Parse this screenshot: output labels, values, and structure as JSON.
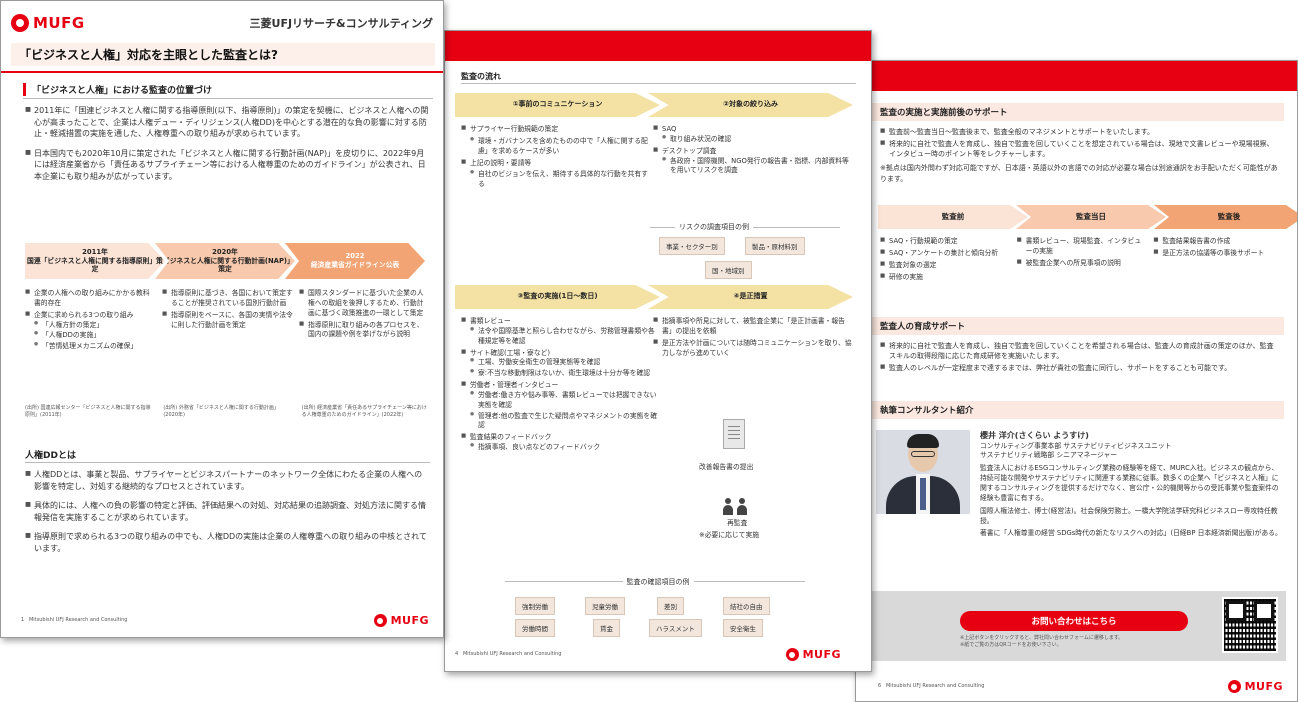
{
  "colors": {
    "brand_red": "#e60012",
    "salmon": "#fdf0ea",
    "gold": "#f4e2a5",
    "peach": "#f8c9ad",
    "orange": "#f2a474"
  },
  "page1": {
    "logo": "MUFG",
    "company": "三菱UFJリサーチ&コンサルティング",
    "title": "「ビジネスと人権」対応を主眼とした監査とは?",
    "section1": "「ビジネスと人権」における監査の位置づけ",
    "intro": [
      "2011年に「国連ビジネスと人権に関する指導原則(以下、指導原則)」の策定を契機に、ビジネスと人権への関心が高まったことで、企業は人権デュー・ディリジェンス(人権DD)を中心とする潜在的な負の影響に対する防止・軽減措置の実施を通した、人権尊重への取り組みが求められています。",
      "日本国内でも2020年10月に策定された「ビジネスと人権に関する行動計画(NAP)」を皮切りに、2022年9月には経済産業省から「責任あるサプライチェーン等における人権尊重のためのガイドライン」が公表され、日本企業にも取り組みが広がっています。"
    ],
    "timeline": [
      {
        "year": "2011年",
        "label": "国連「ビジネスと人権に関する指導原則」策定"
      },
      {
        "year": "2020年",
        "label": "「ビジネスと人権に関する行動計画(NAP)」策定"
      },
      {
        "year": "2022",
        "label": "経済産業省ガイドライン公表"
      }
    ],
    "col1": [
      "企業の人権への取り組みにかかる教科書的存在",
      "企業に求められる3つの取り組み"
    ],
    "col1_sub": [
      "「人権方針の策定」",
      "「人権DDの実施」",
      "「苦情処理メカニズムの確保」"
    ],
    "col2": [
      "指導原則に基づき、各国において策定することが推奨されている国別行動計画",
      "指導原則をベースに、各国の実情や法令に則した行動計画を策定"
    ],
    "col3": [
      "国際スタンダードに基づいた企業の人権への取組を後押しするため、行動計画に基づく政策推進の一環として策定",
      "指導原則に取り組みの各プロセスを、国内の課題や例を挙げながら説明"
    ],
    "sources": [
      "(出所) 国連広報センター「ビジネスと人権に関する指導原則」(2011年)",
      "(出所) 外務省「ビジネスと人権に関する行動計画」(2020年)",
      "(出所) 経済産業省「責任あるサプライチェーン等における人権尊重のためのガイドライン」(2022年)"
    ],
    "section2": "人権DDとは",
    "body2": [
      "人権DDとは、事業と製品、サプライヤーとビジネスパートナーのネットワーク全体にわたる企業の人権への影響を特定し、対処する継続的なプロセスとされています。",
      "具体的には、人権への負の影響の特定と評価、評価結果への対処、対応結果の追跡調査、対処方法に関する情報発信を実施することが求められています。",
      "指導原則で求められる3つの取り組みの中でも、人権DDの実施は企業の人権尊重への取り組みの中核とされています。"
    ],
    "footer_page": "1",
    "footer_text": "Mitsubishi UFJ Research and Consulting"
  },
  "page2": {
    "flow_title": "監査の流れ",
    "step1": "①事前のコミュニケーション",
    "step2": "②対象の絞り込み",
    "step3": "③監査の実施(1日〜数日)",
    "step4": "④是正措置",
    "s1_items": [
      "サプライヤー行動規範の策定",
      "上記の説明・要請等"
    ],
    "s1_sub1": [
      "環境・ガバナンスを含めたものの中で「人権に関する配慮」を求めるケースが多い"
    ],
    "s1_sub2": [
      "自社のビジョンを伝え、期待する具体的な行動を共有する"
    ],
    "s2_items": [
      "SAQ",
      "デスクトップ調査"
    ],
    "s2_sub1": [
      "取り組み状況の確認"
    ],
    "s2_sub2": [
      "各政府・国際機関、NGO発行の報告書・指標、内部資料等を用いてリスクを調査"
    ],
    "risk_title": "リスクの調査項目の例",
    "risk_tags": [
      "事業・セクター別",
      "製品・原材料別",
      "国・地域別"
    ],
    "s3_items": [
      "書類レビュー",
      "サイト確認(工場・寮など)",
      "労働者・管理者インタビュー",
      "監査結果のフィードバック"
    ],
    "s3_sub1": [
      "法令や国際基準と照らし合わせながら、労務管理書類や各種規定等を確認"
    ],
    "s3_sub2": [
      "工場、労働安全衛生の管理実態等を確認",
      "寮:不当な移動制限はないか、衛生環境は十分か等を確認"
    ],
    "s3_sub3": [
      "労働者:働き方や悩み事等、書類レビューでは把握できない実態を確認",
      "管理者:他の監査で生じた疑問点やマネジメントの実態を確認"
    ],
    "s3_sub4": [
      "指摘事項、良い点などのフィードバック"
    ],
    "s4_items": [
      "指摘事項や所見に対して、被監査企業に「是正計画書・報告書」の提出を依頼",
      "是正方法や計画については随時コミュニケーションを取り、協力しながら進めていく"
    ],
    "doc_label": "改善報告書の提出",
    "people_label": "再監査",
    "people_note": "※必要に応じて実施",
    "check_title": "監査の確認項目の例",
    "check_tags": [
      "強制労働",
      "児童労働",
      "差別",
      "結社の自由",
      "労働時間",
      "賃金",
      "ハラスメント",
      "安全衛生"
    ],
    "footer_page": "4",
    "footer_text": "Mitsubishi UFJ Research and Consulting",
    "logo": "MUFG"
  },
  "page3": {
    "h1": "監査の実施と実施前後のサポート",
    "intro": [
      "監査前〜監査当日〜監査後まで、監査全般のマネジメントとサポートをいたします。",
      "将来的に自社で監査人を育成し、独自で監査を回していくことを想定されている場合は、現地で文書レビューや現場視察、インタビュー時のポイント等をレクチャーします。"
    ],
    "note": "※拠点は国内外問わず対応可能ですが、日本語・英語以外の言語での対応が必要な場合は別途通訳をお手配いただく可能性があります。",
    "phases": [
      "監査前",
      "監査当日",
      "監査後"
    ],
    "col1": [
      "SAQ・行動規範の策定",
      "SAQ・アンケートの集計と傾向分析",
      "監査対象の選定",
      "研修の実施"
    ],
    "col2": [
      "書類レビュー、現場監査、インタビューの実施",
      "被監査企業への所見事項の説明"
    ],
    "col3": [
      "監査結果報告書の作成",
      "是正方法の協議等の事後サポート"
    ],
    "h2": "監査人の育成サポート",
    "h2_items": [
      "将来的に自社で監査人を育成し、独自で監査を回していくことを希望される場合は、監査人の育成計画の策定のほか、監査スキルの取得段階に応じた育成研修を実施いたします。",
      "監査人のレベルが一定程度まで達するまでは、弊社が貴社の監査に同行し、サポートをすることも可能です。"
    ],
    "h3": "執筆コンサルタント紹介",
    "name": "櫻井 洋介(さくらい ようすけ)",
    "dept": "コンサルティング事業本部 サステナビリティビジネスユニット",
    "role": "サステナビリティ戦略部 シニアマネージャー",
    "bio1": "監査法人におけるESGコンサルティング業務の経験等を経て、MURC入社。ビジネスの観点から、持続可能な開発やサステナビリティに関連する業務に従事。数多くの企業へ「ビジネスと人権」に関するコンサルティングを提供するだけでなく、官公庁・公的機関等からの受託事業や監査案件の経験も豊富に有する。",
    "bio2": "国際人権法修士、博士(経営法)。社会保険労務士。一橋大学院法学研究科ビジネスロー専攻特任教授。",
    "bio3": "著書に「人権尊重の経営 SDGs時代の新たなリスクへの対応」(日経BP 日本経済新聞出版)がある。",
    "cta": "お問い合わせはこちら",
    "cta_notes": [
      "※上記ボタンをクリックすると、弊社問い合わせフォームに遷移します。",
      "※紙でご覧の方はQRコードをお使い下さい。"
    ],
    "footer_page": "6",
    "footer_text": "Mitsubishi UFJ Research and Consulting",
    "logo": "MUFG"
  }
}
